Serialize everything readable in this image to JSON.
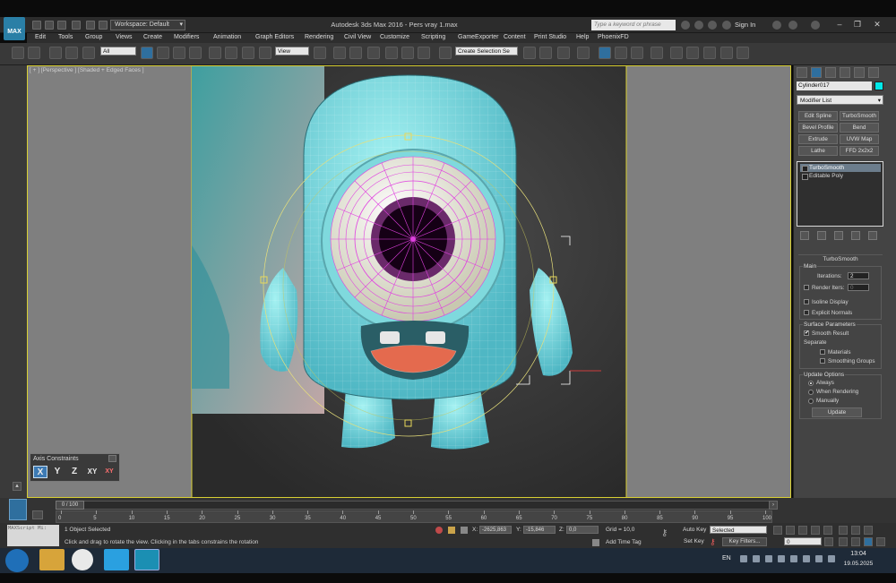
{
  "titlebar": {
    "logo": "MAX",
    "workspace": "Workspace: Default",
    "app_title": "Autodesk 3ds Max 2016 - Pers vray 1.max",
    "search_placeholder": "Type a keyword or phrase",
    "sign_in": "Sign In",
    "icons": [
      "search-icon",
      "user-icon",
      "cart-icon",
      "exchange-icon",
      "help-icon"
    ]
  },
  "menu": [
    "Edit",
    "Tools",
    "Group",
    "Views",
    "Create",
    "Modifiers",
    "Animation",
    "Graph Editors",
    "Rendering",
    "Civil View",
    "Customize",
    "Scripting",
    "GameExporter",
    "Content",
    "Print Studio",
    "Help",
    "PhoenixFD"
  ],
  "toolbar": {
    "selection_filter": "All",
    "ref_coord": "View",
    "named_selection": "Create Selection Se"
  },
  "viewport": {
    "label": "[ + ] [Perspective ] [Shaded + Edged Faces ]"
  },
  "command_panel": {
    "object_name": "Cylinder017",
    "object_color": "#00e8e8",
    "modifier_list": "Modifier List",
    "modifier_buttons": [
      "Edit Spline",
      "TurboSmooth",
      "Bevel Profile",
      "Bend",
      "Extrude",
      "UVW Map",
      "Lathe",
      "FFD 2x2x2"
    ],
    "stack": [
      "TurboSmooth",
      "Editable Poly"
    ],
    "rollout_title": "TurboSmooth",
    "main_group": "Main",
    "iterations_label": "Iterations:",
    "iterations_value": "2",
    "render_iters_label": "Render Iters:",
    "render_iters_value": "0",
    "isoline_display": "Isoline Display",
    "explicit_normals": "Explicit Normals",
    "surface_params": "Surface Parameters",
    "smooth_result": "Smooth Result",
    "separate": "Separate",
    "materials": "Materials",
    "smoothing_groups": "Smoothing Groups",
    "update_options": "Update Options",
    "always": "Always",
    "when_rendering": "When Rendering",
    "manually": "Manually",
    "update_button": "Update",
    "check_mark": "✔"
  },
  "axis_constraints": {
    "title": "Axis Constraints",
    "buttons": [
      "X",
      "Y",
      "Z",
      "XY",
      "XY"
    ]
  },
  "timeline": {
    "frame": "0 / 100",
    "ticks": [
      "0",
      "5",
      "10",
      "15",
      "20",
      "25",
      "30",
      "35",
      "40",
      "45",
      "50",
      "55",
      "60",
      "65",
      "70",
      "75",
      "80",
      "85",
      "90",
      "95",
      "100"
    ]
  },
  "status": {
    "maxscript": "MAXScript Mi:",
    "selected": "1 Object Selected",
    "prompt": "Click and drag to rotate the view.  Clicking in the tabs constrains the rotation",
    "x_label": "X:",
    "x_value": "-2625,863",
    "y_label": "Y:",
    "y_value": "-15,846",
    "z_label": "Z:",
    "z_value": "0,0",
    "grid": "Grid = 10,0",
    "add_time_tag": "Add Time Tag",
    "auto_key": "Auto Key",
    "set_key": "Set Key",
    "selected_set": "Selected",
    "key_filters": "Key Filters...",
    "frame_field": "0"
  },
  "taskbar": {
    "lang": "EN",
    "time": "13:04",
    "date": "19.05.2025"
  }
}
